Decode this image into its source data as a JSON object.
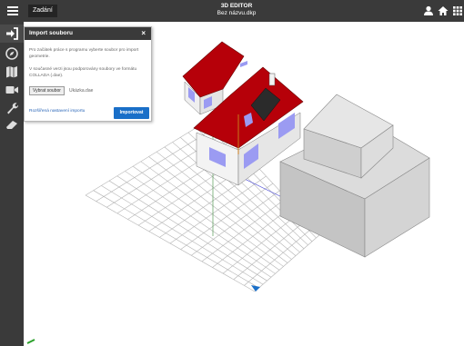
{
  "topbar": {
    "menu_icon": "hamburger-icon",
    "tab_label": "Zadání",
    "app_title": "3D EDITOR",
    "file_name": "Bez názvu.dkp",
    "right_icons": [
      "user-icon",
      "home-icon",
      "grid-icon"
    ]
  },
  "sidebar": {
    "items": [
      {
        "icon": "sign-in-icon",
        "active": true
      },
      {
        "icon": "compass-icon"
      },
      {
        "icon": "map-icon"
      },
      {
        "icon": "video-camera-icon"
      },
      {
        "icon": "wrench-icon"
      },
      {
        "icon": "eraser-icon"
      }
    ]
  },
  "import_panel": {
    "title": "Import souboru",
    "close_label": "×",
    "text1": "Pro začátek práce s programu vyberte soubor pro import geometrie.",
    "text2": "V současné verzi jsou podporovány soubory ve formátu COLLADA (.dae).",
    "choose_file_label": "Vybrat soubor",
    "file_value": "Ukázka.dae",
    "advanced_link": "Rozšířená nastavení importu",
    "import_button": "Importovat"
  },
  "colors": {
    "toolbar_bg": "#3a3a3a",
    "roof": "#b8000a",
    "window": "#9b9bf2",
    "wall": "#f2f2f2",
    "block": "#c8c8c8",
    "grid": "#aaaaaa",
    "accent": "#1a6fc8"
  }
}
